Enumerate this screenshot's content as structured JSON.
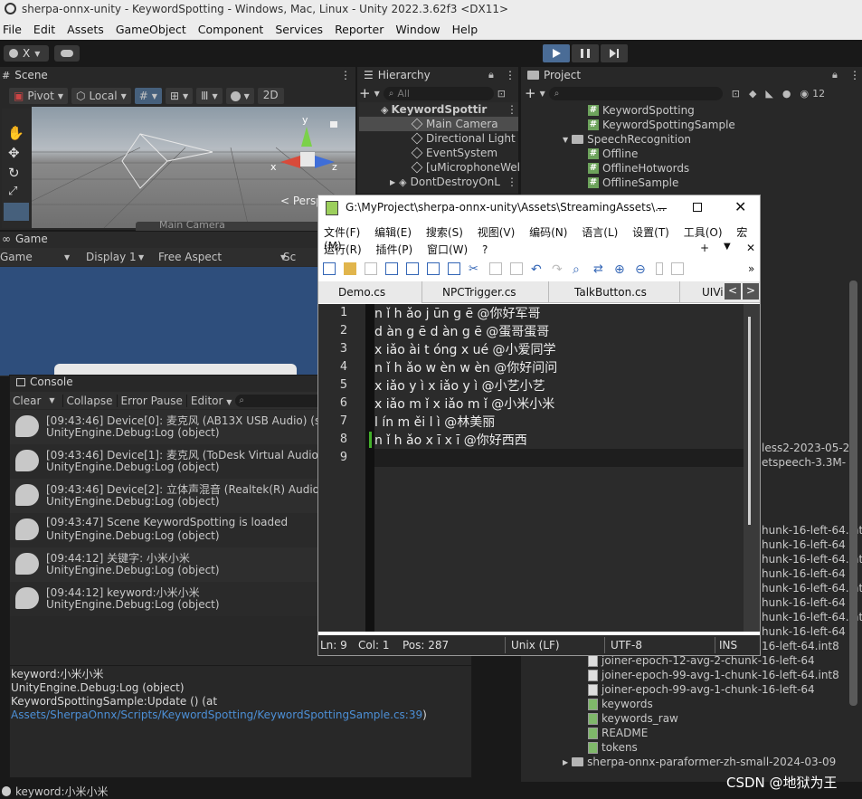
{
  "window_title": "sherpa-onnx-unity - KeywordSpotting - Windows, Mac, Linux - Unity 2022.3.62f3 <DX11>",
  "menu": [
    "File",
    "Edit",
    "Assets",
    "GameObject",
    "Component",
    "Services",
    "Reporter",
    "Window",
    "Help"
  ],
  "toolbar": {
    "account": "X",
    "layer_dropdown_icon": "cloud-icon"
  },
  "scene": {
    "tab": "Scene",
    "pivot": "Pivot",
    "local": "Local",
    "mode_2d": "2D",
    "persp": "< Persp",
    "main_camera_label": "Main Camera",
    "gizmo_y": "y",
    "gizmo_x": "x",
    "gizmo_z": "z"
  },
  "game": {
    "tab": "Game",
    "view": "Game",
    "display": "Display 1",
    "aspect": "Free Aspect",
    "scale": "Sc"
  },
  "hierarchy": {
    "tab": "Hierarchy",
    "search_placeholder": "All",
    "root": "KeywordSpottir",
    "items": [
      "Main Camera",
      "Directional Light",
      "EventSystem",
      "[uMicrophoneWel"
    ],
    "ddol": "DontDestroyOnL"
  },
  "project": {
    "tab": "Project",
    "count": "12",
    "items_top": [
      "KeywordSpotting",
      "KeywordSpottingSample"
    ],
    "speech_folder": "SpeechRecognition",
    "speech_items": [
      "Offline",
      "OfflineHotwords",
      "OfflineSample"
    ],
    "partial_right": [
      "less2-2023-05-2",
      "etspeech-3.3M-",
      "",
      "hunk-16-left-64.int8",
      "hunk-16-left-64",
      "hunk-16-left-64.int8",
      "hunk-16-left-64",
      "hunk-16-left-64.int8",
      "hunk-16-left-64",
      "hunk-16-left-64.int8",
      "hunk-16-left-64",
      "16-left-64.int8"
    ],
    "bottom_items": [
      "joiner-epoch-12-avg-2-chunk-16-left-64",
      "joiner-epoch-99-avg-1-chunk-16-left-64.int8",
      "joiner-epoch-99-avg-1-chunk-16-left-64",
      "keywords",
      "keywords_raw",
      "README",
      "tokens"
    ],
    "last_folder": "sherpa-onnx-paraformer-zh-small-2024-03-09"
  },
  "console": {
    "tab": "Console",
    "clear": "Clear",
    "collapse": "Collapse",
    "error_pause": "Error Pause",
    "editor": "Editor",
    "logs": [
      {
        "line1": "[09:43:46] Device[0]: 麦克风 (AB13X USB Audio) (sam",
        "line2": "UnityEngine.Debug:Log (object)"
      },
      {
        "line1": "[09:43:46] Device[1]: 麦克风 (ToDesk Virtual Audio) (s",
        "line2": "UnityEngine.Debug:Log (object)"
      },
      {
        "line1": "[09:43:46] Device[2]: 立体声混音 (Realtek(R) Audio) (s",
        "line2": "UnityEngine.Debug:Log (object)"
      },
      {
        "line1": "[09:43:47] Scene KeywordSpotting is loaded",
        "line2": "UnityEngine.Debug:Log (object)"
      },
      {
        "line1": "[09:44:12] 关键字: 小米小米",
        "line2": "UnityEngine.Debug:Log (object)"
      },
      {
        "line1": "[09:44:12] keyword:小米小米",
        "line2": "UnityEngine.Debug:Log (object)"
      }
    ],
    "detail": [
      "keyword:小米小米",
      "UnityEngine.Debug:Log (object)",
      "KeywordSpottingSample:Update () (at"
    ],
    "detail_link": "Assets/SherpaOnnx/Scripts/KeywordSpotting/KeywordSpottingSample.cs:39",
    "detail_link_suffix": ")"
  },
  "statusbar": {
    "text": "keyword:小米小米",
    "watermark": "CSDN @地狱为王"
  },
  "notepad": {
    "title": "G:\\MyProject\\sherpa-onnx-unity\\Assets\\StreamingAssets\\...",
    "menu1": [
      "文件(F)",
      "编辑(E)",
      "搜索(S)",
      "视图(V)",
      "编码(N)",
      "语言(L)",
      "设置(T)",
      "工具(O)",
      "宏(M)"
    ],
    "menu2": [
      "运行(R)",
      "插件(P)",
      "窗口(W)",
      "?"
    ],
    "menu2_right": [
      "+",
      "▼",
      "✕"
    ],
    "tabs": [
      "Demo.cs",
      "NPCTrigger.cs",
      "TalkButton.cs",
      "UIVi"
    ],
    "lines": [
      {
        "n": "1",
        "t": "n ǐ h ǎo j ūn g ē @你好军哥"
      },
      {
        "n": "2",
        "t": "d àn g ē d àn g ē @蛋哥蛋哥"
      },
      {
        "n": "3",
        "t": "x iǎo ài t óng x ué @小爱同学"
      },
      {
        "n": "4",
        "t": "n ǐ h ǎo w èn w èn @你好问问"
      },
      {
        "n": "5",
        "t": "x iǎo y ì x iǎo y ì @小艺小艺"
      },
      {
        "n": "6",
        "t": "x iǎo m ǐ x iǎo m ǐ @小米小米"
      },
      {
        "n": "7",
        "t": "l ín m ěi l ì @林美丽"
      },
      {
        "n": "8",
        "t": "n ǐ h ǎo x ī x ī @你好西西"
      },
      {
        "n": "9",
        "t": ""
      }
    ],
    "status": {
      "ln": "Ln: 9",
      "col": "Col: 1",
      "pos": "Pos: 287",
      "eol": "Unix (LF)",
      "enc": "UTF-8",
      "ins": "INS"
    }
  }
}
